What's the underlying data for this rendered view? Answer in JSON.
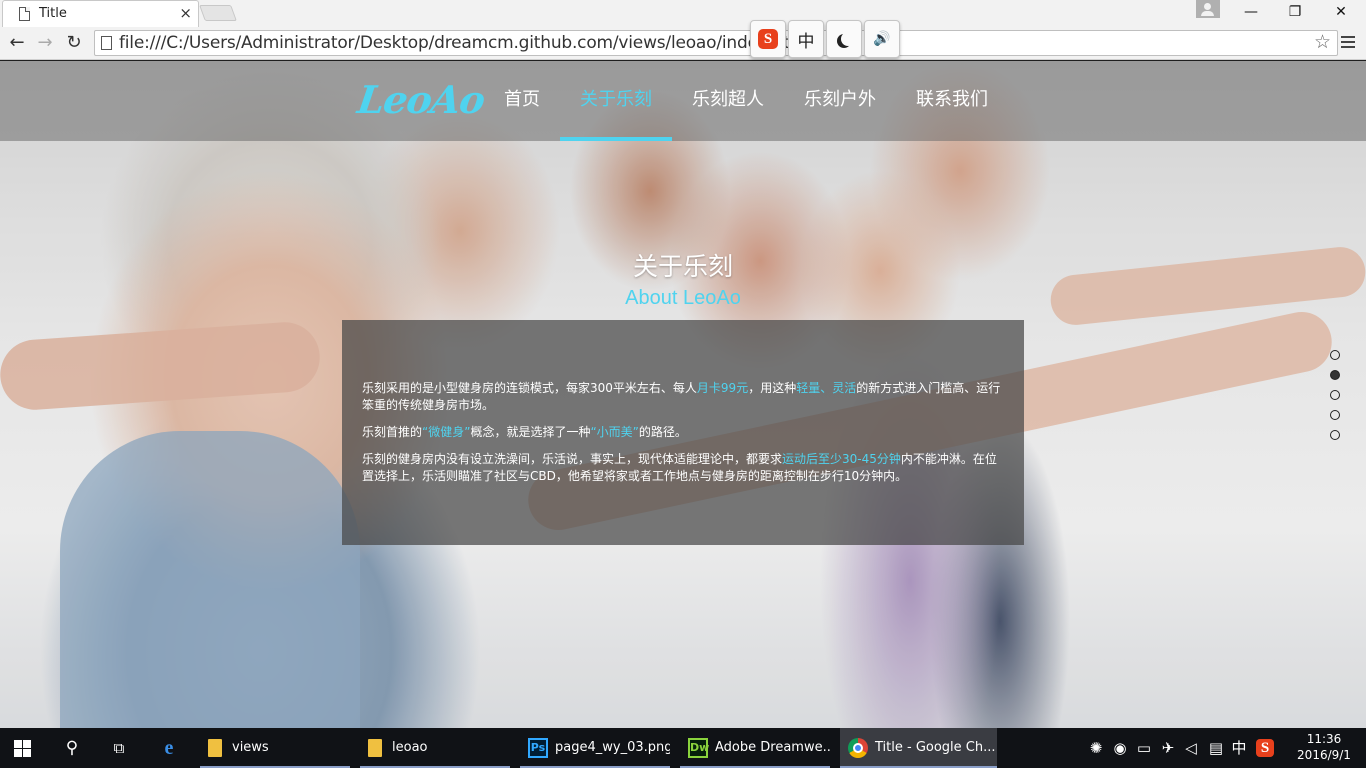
{
  "browser": {
    "tab_title": "Title",
    "tab_close": "×",
    "url": "file:///C:/Users/Administrator/Desktop/dreamcm.github.com/views/leoao/index.ht",
    "back": "←",
    "forward": "→",
    "reload": "↻",
    "star": "☆",
    "minimize": "—",
    "maximize": "❐",
    "close": "✕"
  },
  "ime": {
    "sogou": "S",
    "lang": "中",
    "sound": "🔊"
  },
  "site": {
    "logo": "LeoAo",
    "nav": [
      {
        "label": "首页",
        "active": false
      },
      {
        "label": "关于乐刻",
        "active": true
      },
      {
        "label": "乐刻超人",
        "active": false
      },
      {
        "label": "乐刻户外",
        "active": false
      },
      {
        "label": "联系我们",
        "active": false
      }
    ],
    "section_title": "关于乐刻",
    "section_subtitle": "About LeoAo",
    "para1": {
      "a": "乐刻采用的是小型健身房的连锁模式，每家300平米左右、每人",
      "b": "月卡99元",
      "c": "，用这种",
      "d": "轻量、灵活",
      "e": "的新方式进入门槛高、运行笨重的传统健身房市场。"
    },
    "para2": {
      "a": "乐刻首推的",
      "b": "“微健身”",
      "c": "概念，就是选择了一种",
      "d": "“小而美”",
      "e": "的路径。"
    },
    "para3": {
      "a": "乐刻的健身房内没有设立洗澡间，乐活说，事实上，现代体适能理论中，都要求",
      "b": "运动后至少30-45分钟",
      "c": "内不能冲淋。在位置选择上，乐活则瞄准了社区与CBD，他希望将家或者工作地点与健身房的距离控制在步行10分钟内。"
    },
    "pager": {
      "count": 5,
      "active_index": 1
    }
  },
  "taskbar": {
    "tasks": [
      {
        "label": "views"
      },
      {
        "label": "leoao"
      },
      {
        "label": "page4_wy_03.png..."
      },
      {
        "label": "Adobe Dreamwe..."
      },
      {
        "label": "Title - Google Ch..."
      }
    ],
    "ps_label": "Ps",
    "dw_label": "Dw",
    "ime_lang": "中",
    "time": "11:36",
    "date": "2016/9/1"
  },
  "colors": {
    "accent": "#4fd3ef",
    "taskbar": "#101216"
  }
}
